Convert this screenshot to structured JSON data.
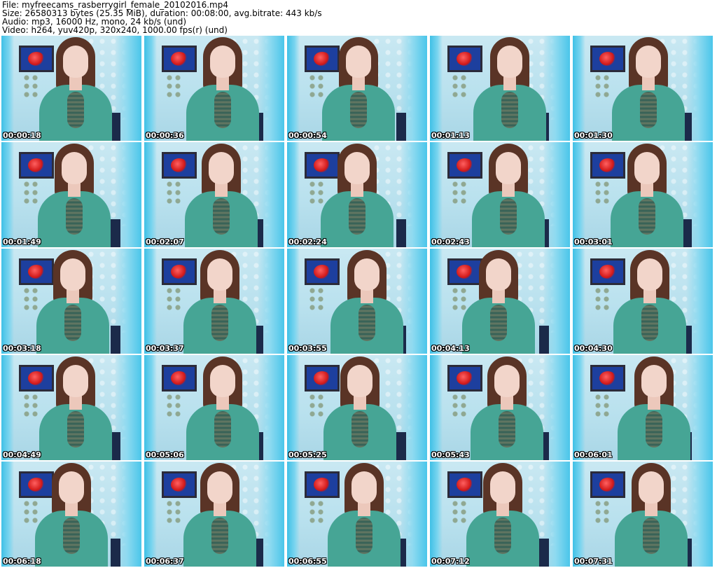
{
  "header": {
    "file": "File: myfreecams_rasberrygirl_female_20102016.mp4",
    "size": "Size: 26580313 bytes (25.35 MiB), duration: 00:08:00, avg.bitrate: 443 kb/s",
    "audio": "Audio: mp3, 16000 Hz, mono, 24 kb/s (und)",
    "video": "Video: h264, yuv420p, 320x240, 1000.00 fps(r) (und)"
  },
  "thumbnails": [
    {
      "timestamp": "00:00:18"
    },
    {
      "timestamp": "00:00:36"
    },
    {
      "timestamp": "00:00:54"
    },
    {
      "timestamp": "00:01:13"
    },
    {
      "timestamp": "00:01:30"
    },
    {
      "timestamp": "00:01:49"
    },
    {
      "timestamp": "00:02:07"
    },
    {
      "timestamp": "00:02:24"
    },
    {
      "timestamp": "00:02:43"
    },
    {
      "timestamp": "00:03:01"
    },
    {
      "timestamp": "00:03:18"
    },
    {
      "timestamp": "00:03:37"
    },
    {
      "timestamp": "00:03:55"
    },
    {
      "timestamp": "00:04:13"
    },
    {
      "timestamp": "00:04:30"
    },
    {
      "timestamp": "00:04:49"
    },
    {
      "timestamp": "00:05:06"
    },
    {
      "timestamp": "00:05:25"
    },
    {
      "timestamp": "00:05:43"
    },
    {
      "timestamp": "00:06:01"
    },
    {
      "timestamp": "00:06:18"
    },
    {
      "timestamp": "00:06:37"
    },
    {
      "timestamp": "00:06:55"
    },
    {
      "timestamp": "00:07:12"
    },
    {
      "timestamp": "00:07:31"
    }
  ]
}
